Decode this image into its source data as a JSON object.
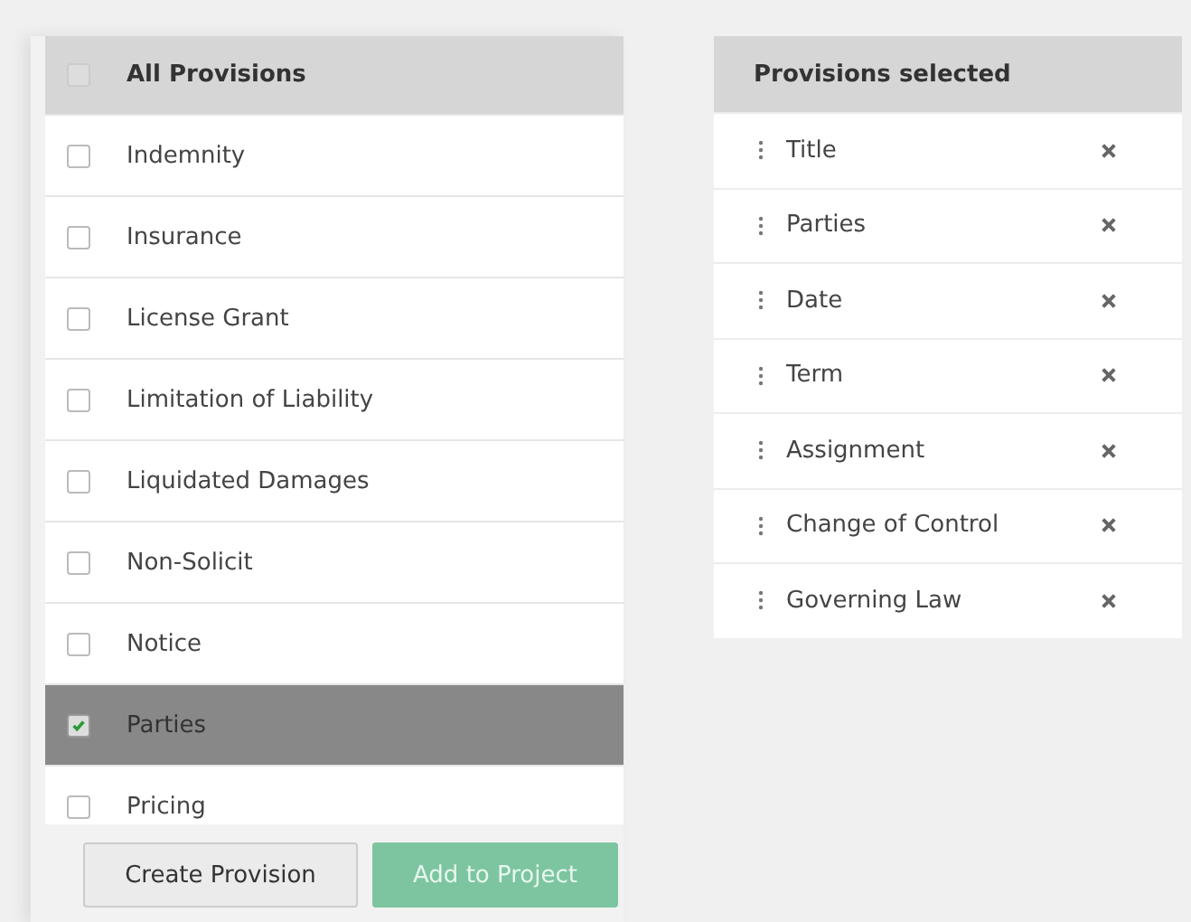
{
  "all_provisions": {
    "header": {
      "label": "All Provisions",
      "checked": false
    },
    "items": [
      {
        "label": "Indemnity",
        "checked": false
      },
      {
        "label": "Insurance",
        "checked": false
      },
      {
        "label": "License Grant",
        "checked": false
      },
      {
        "label": "Limitation of Liability",
        "checked": false
      },
      {
        "label": "Liquidated Damages",
        "checked": false
      },
      {
        "label": "Non-Solicit",
        "checked": false
      },
      {
        "label": "Notice",
        "checked": false
      },
      {
        "label": "Parties",
        "checked": true
      },
      {
        "label": "Pricing",
        "checked": false
      }
    ]
  },
  "buttons": [
    {
      "label": "Create Provision",
      "kind": "secondary",
      "disabled": false
    },
    {
      "label": "Add to Project",
      "kind": "primary",
      "disabled": true
    }
  ],
  "provisions_selected": {
    "title": "Provisions selected",
    "items": [
      {
        "label": "Title"
      },
      {
        "label": "Parties"
      },
      {
        "label": "Date"
      },
      {
        "label": "Term"
      },
      {
        "label": "Assignment"
      },
      {
        "label": "Change of Control"
      },
      {
        "label": "Governing Law"
      }
    ]
  }
}
